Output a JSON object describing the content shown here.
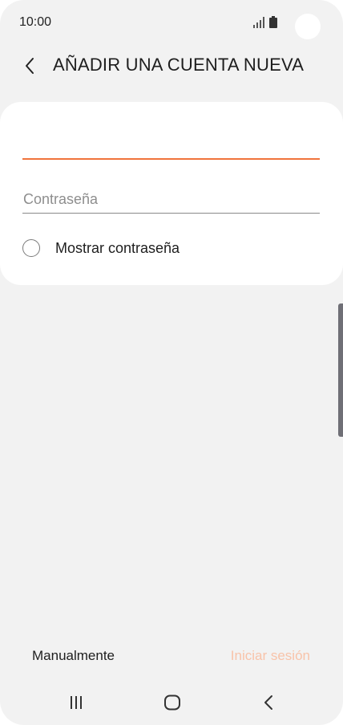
{
  "status_bar": {
    "time": "10:00",
    "signal_icon": "signal-icon",
    "battery_icon": "battery-icon"
  },
  "header": {
    "back_icon": "chevron-left-icon",
    "title": "AÑADIR UNA CUENTA NUEVA"
  },
  "form": {
    "email": {
      "value": "",
      "placeholder": ""
    },
    "password": {
      "value": "",
      "placeholder": "Contraseña"
    },
    "show_password": {
      "label": "Mostrar contraseña",
      "checked": false
    }
  },
  "actions": {
    "manual_label": "Manualmente",
    "signin_label": "Iniciar sesión",
    "signin_enabled": false
  },
  "nav_bar": {
    "recents_icon": "recents-icon",
    "home_icon": "home-icon",
    "back_icon": "back-icon"
  },
  "colors": {
    "accent": "#f0743c",
    "disabled_accent": "#f8c3a9",
    "background": "#f2f2f2",
    "card": "#ffffff"
  }
}
